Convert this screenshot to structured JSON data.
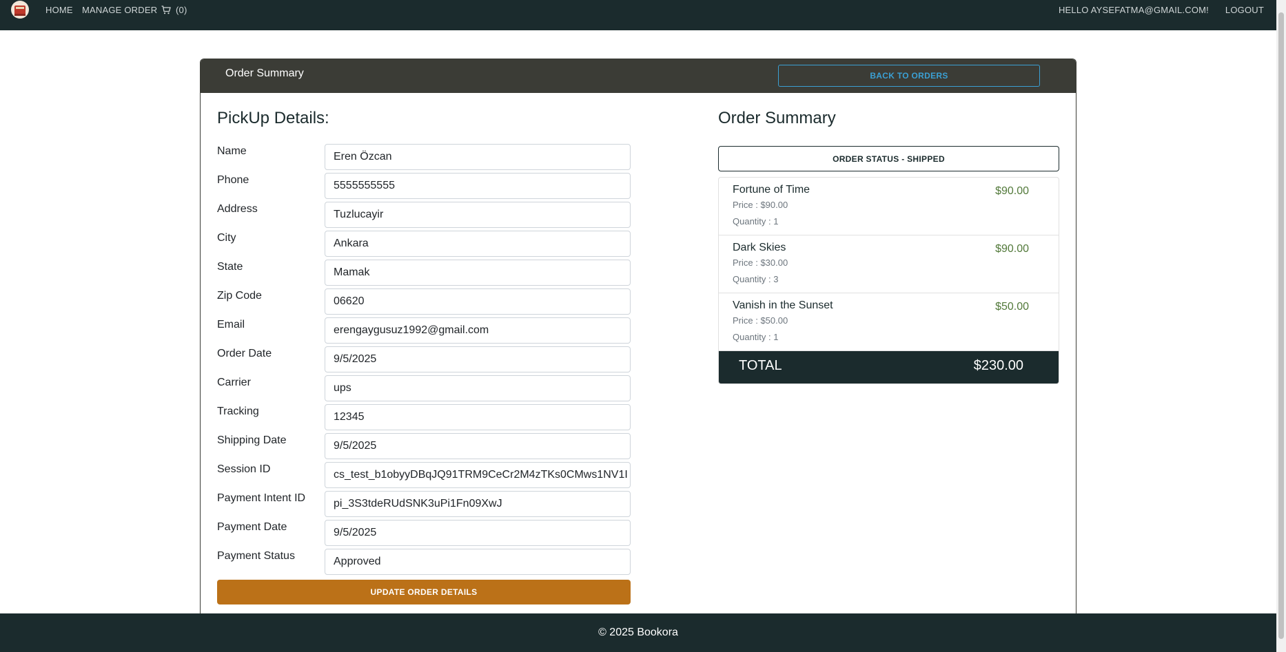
{
  "nav": {
    "home": "HOME",
    "manage_order": "MANAGE ORDER",
    "cart_count": "(0)",
    "greeting": "HELLO AYSEFATMA@GMAIL.COM!",
    "logout": "LOGOUT"
  },
  "card": {
    "header_title": "Order Summary",
    "back_button": "BACK TO ORDERS"
  },
  "pickup": {
    "heading": "PickUp Details:",
    "fields": [
      {
        "label": "Name",
        "value": "Eren Özcan"
      },
      {
        "label": "Phone",
        "value": "5555555555"
      },
      {
        "label": "Address",
        "value": "Tuzlucayir"
      },
      {
        "label": "City",
        "value": "Ankara"
      },
      {
        "label": "State",
        "value": "Mamak"
      },
      {
        "label": "Zip Code",
        "value": "06620"
      },
      {
        "label": "Email",
        "value": "erengaygusuz1992@gmail.com"
      },
      {
        "label": "Order Date",
        "value": "9/5/2025"
      },
      {
        "label": "Carrier",
        "value": "ups"
      },
      {
        "label": "Tracking",
        "value": "12345"
      },
      {
        "label": "Shipping Date",
        "value": "9/5/2025"
      },
      {
        "label": "Session ID",
        "value": "cs_test_b1obyyDBqJQ91TRM9CeCr2M4zTKs0CMws1NV1I"
      },
      {
        "label": "Payment Intent ID",
        "value": "pi_3S3tdeRUdSNK3uPi1Fn09XwJ"
      },
      {
        "label": "Payment Date",
        "value": "9/5/2025"
      },
      {
        "label": "Payment Status",
        "value": "Approved"
      }
    ],
    "update_button": "UPDATE ORDER DETAILS"
  },
  "summary": {
    "heading": "Order Summary",
    "status": "ORDER STATUS - SHIPPED",
    "items": [
      {
        "title": "Fortune of Time",
        "price": "Price : $90.00",
        "quantity": "Quantity : 1",
        "total": "$90.00"
      },
      {
        "title": "Dark Skies",
        "price": "Price : $30.00",
        "quantity": "Quantity : 3",
        "total": "$90.00"
      },
      {
        "title": "Vanish in the Sunset",
        "price": "Price : $50.00",
        "quantity": "Quantity : 1",
        "total": "$50.00"
      }
    ],
    "total_label": "TOTAL",
    "total_value": "$230.00"
  },
  "footer": {
    "text": "© 2025 Bookora"
  },
  "colors": {
    "navbar": "#1b2b2d",
    "card_header": "#3b3c36",
    "accent_blue": "#3ba0d4",
    "update_button": "#bb7118",
    "item_total": "#52793a"
  }
}
